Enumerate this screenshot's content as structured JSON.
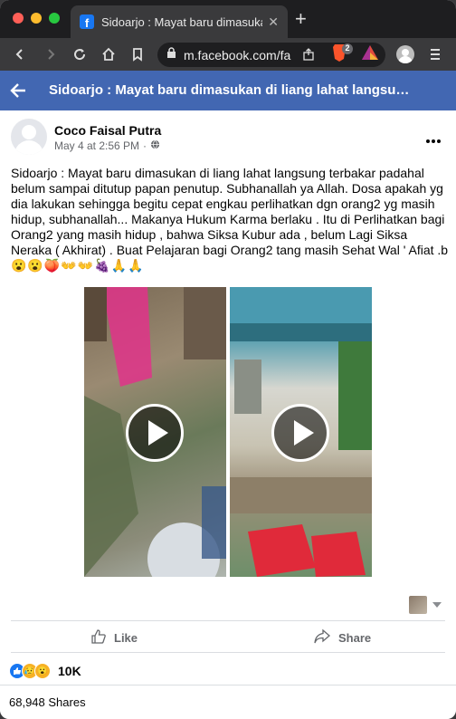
{
  "browser": {
    "tab_title": "Sidoarjo : Mayat baru dimasukan",
    "tab_favicon": "facebook-f",
    "url": "m.facebook.com/fa",
    "shield_badge": "2"
  },
  "header": {
    "title": "Sidoarjo : Mayat baru dimasukan di liang lahat langsu…"
  },
  "post": {
    "author": "Coco Faisal Putra",
    "timestamp": "May 4 at 2:56 PM",
    "text": "Sidoarjo : Mayat baru dimasukan di liang lahat langsung terbakar padahal belum sampai ditutup papan penutup. Subhanallah ya Allah. Dosa apakah yg dia lakukan sehingga begitu cepat engkau perlihatkan dgn orang2 yg masih hidup, subhanallah... Makanya Hukum Karma berlaku . Itu di Perlihatkan bagi Orang2 yang masih hidup , bahwa Siksa Kubur ada , belum Lagi Siksa Neraka ( Akhirat) . Buat Pelajaran bagi Orang2 tang masih Sehat Wal ' Afiat .b",
    "emojis": "😮😮🍑👐👐🍇🙏🙏",
    "like_label": "Like",
    "share_label": "Share",
    "reaction_count": "10K",
    "shares_text": "68,948 Shares"
  },
  "colors": {
    "fb_blue": "#4267b2",
    "link_blue": "#1877f2"
  }
}
